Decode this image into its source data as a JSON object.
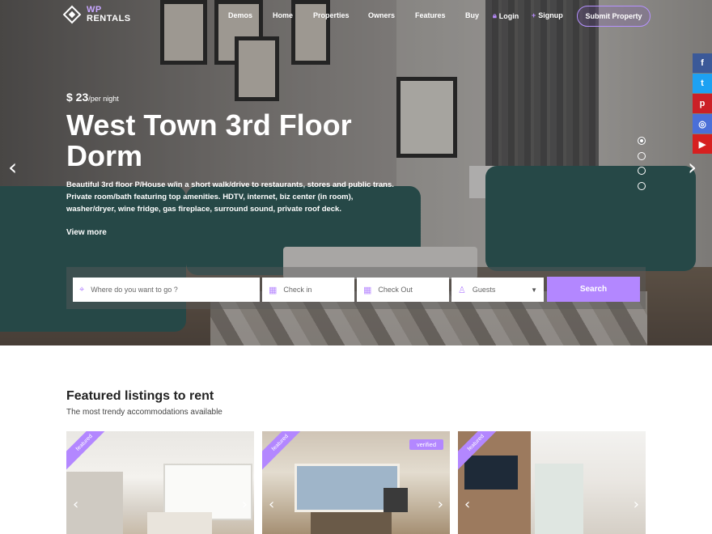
{
  "nav": {
    "logo_top": "WP",
    "logo_bottom": "RENTALS",
    "items": [
      {
        "label": "Demos"
      },
      {
        "label": "Home"
      },
      {
        "label": "Properties"
      },
      {
        "label": "Owners"
      },
      {
        "label": "Features"
      },
      {
        "label": "Buy"
      }
    ],
    "login": "Login",
    "signup": "Signup",
    "submit": "Submit Property"
  },
  "hero": {
    "price": "$ 23",
    "price_unit": "/per night",
    "title": "West Town 3rd Floor Dorm",
    "description": "Beautiful 3rd floor P/House w/in a short walk/drive to restaurants, stores and public trans. Private room/bath featuring top amenities. HDTV, internet, biz center (in room), washer/dryer, wine fridge, gas fireplace, surround sound, private roof deck.",
    "view_more": "View more",
    "slides_total": 4,
    "slide_active": 1
  },
  "social": [
    {
      "icon": "facebook-icon",
      "glyph": "f",
      "color": "#3b5998"
    },
    {
      "icon": "twitter-icon",
      "glyph": "t",
      "color": "#1da1f2"
    },
    {
      "icon": "pinterest-icon",
      "glyph": "p",
      "color": "#cb2027"
    },
    {
      "icon": "instagram-icon",
      "glyph": "◎",
      "color": "#4a6fd8"
    },
    {
      "icon": "youtube-icon",
      "glyph": "▶",
      "color": "#d62020"
    }
  ],
  "search": {
    "where_placeholder": "Where do you want to go ?",
    "checkin_placeholder": "Check in",
    "checkout_placeholder": "Check Out",
    "guests_placeholder": "Guests",
    "button": "Search"
  },
  "featured": {
    "title": "Featured listings to rent",
    "subtitle": "The most trendy accommodations available",
    "cards": [
      {
        "ribbon": "featured"
      },
      {
        "ribbon": "featured",
        "badge": "verified"
      },
      {
        "ribbon": "featured"
      }
    ]
  },
  "colors": {
    "accent": "#b387ff"
  }
}
